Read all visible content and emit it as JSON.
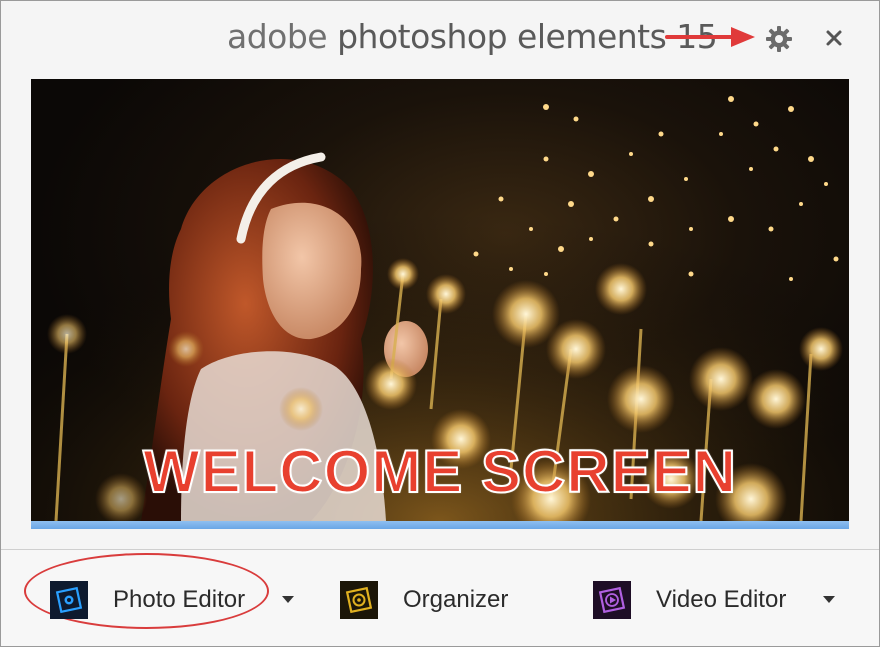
{
  "window": {
    "title_word1": "adobe",
    "title_word2": "photoshop elements 15"
  },
  "hero": {
    "caption": "WELCOME SCREEN",
    "progress": 1.0
  },
  "launchers": [
    {
      "label": "Photo Editor",
      "icon": "photo-editor-icon",
      "has_dropdown": true,
      "accent": "#1f8fff"
    },
    {
      "label": "Organizer",
      "icon": "organizer-icon",
      "has_dropdown": false,
      "accent": "#e0b020"
    },
    {
      "label": "Video Editor",
      "icon": "video-editor-icon",
      "has_dropdown": true,
      "accent": "#b060e0"
    }
  ],
  "colors": {
    "annotation_red": "#e8402f",
    "progress_blue": "#7ab2ea"
  },
  "icons": [
    "settings-gear-icon",
    "close-icon",
    "annotation-arrow-icon",
    "dropdown-arrow-icon"
  ]
}
